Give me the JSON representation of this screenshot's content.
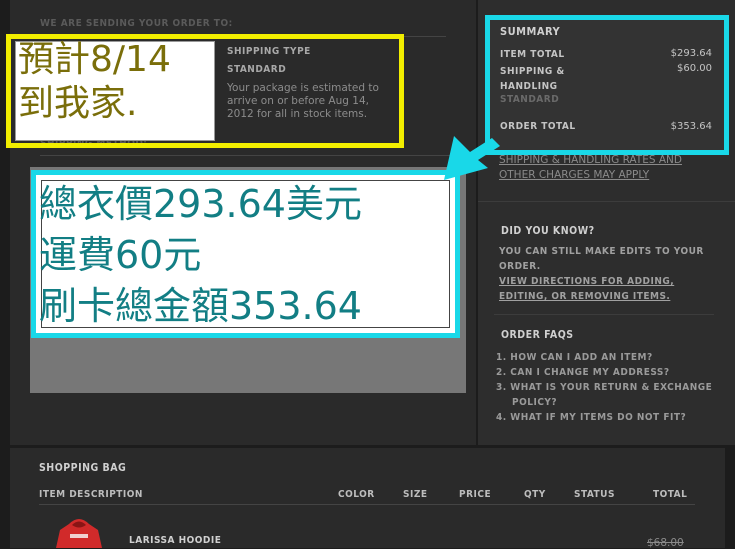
{
  "page": {
    "sending_header": "WE ARE SENDING YOUR ORDER TO:",
    "hidden_header2": "SHIPPING METHOD:"
  },
  "shipping": {
    "type_label": "SHIPPING TYPE",
    "type_value": "STANDARD",
    "estimate_text": "Your package is estimated to arrive on or before Aug 14, 2012 for all in stock items."
  },
  "summary": {
    "title": "SUMMARY",
    "item_total_label": "ITEM TOTAL",
    "item_total_value": "$293.64",
    "shipping_label": "SHIPPING & HANDLING",
    "shipping_value": "$60.00",
    "shipping_sub": "STANDARD",
    "order_total_label": "ORDER TOTAL",
    "order_total_value": "$353.64",
    "rates_link": "SHIPPING & HANDLING RATES AND OTHER CHARGES MAY APPLY"
  },
  "did_you_know": {
    "title": "DID YOU KNOW?",
    "text": "YOU CAN STILL MAKE EDITS TO YOUR ORDER.",
    "link": "VIEW DIRECTIONS FOR ADDING, EDITING, OR REMOVING ITEMS."
  },
  "faqs": {
    "title": "ORDER FAQS",
    "items": [
      "1.  HOW CAN I ADD AN ITEM?",
      "2.  CAN I CHANGE MY ADDRESS?",
      "3.  WHAT IS YOUR RETURN & EXCHANGE",
      "POLICY?",
      "4.  WHAT IF MY ITEMS DO NOT FIT?"
    ]
  },
  "bag": {
    "title": "SHOPPING BAG",
    "columns": [
      "ITEM DESCRIPTION",
      "COLOR",
      "SIZE",
      "PRICE",
      "QTY",
      "STATUS",
      "TOTAL"
    ],
    "item_name": "LARISSA HOODIE",
    "item_price": "$68.00"
  },
  "annotations": {
    "yellow_text": "預計8/14\n到我家.",
    "cyan_text": "總衣價293.64美元\n運費60元\n刷卡總金額353.64"
  },
  "colors": {
    "yellow": "#f2ee00",
    "cyan": "#19d8e8",
    "cyan_text": "#127e84",
    "yellow_text": "#7a6e0a"
  }
}
